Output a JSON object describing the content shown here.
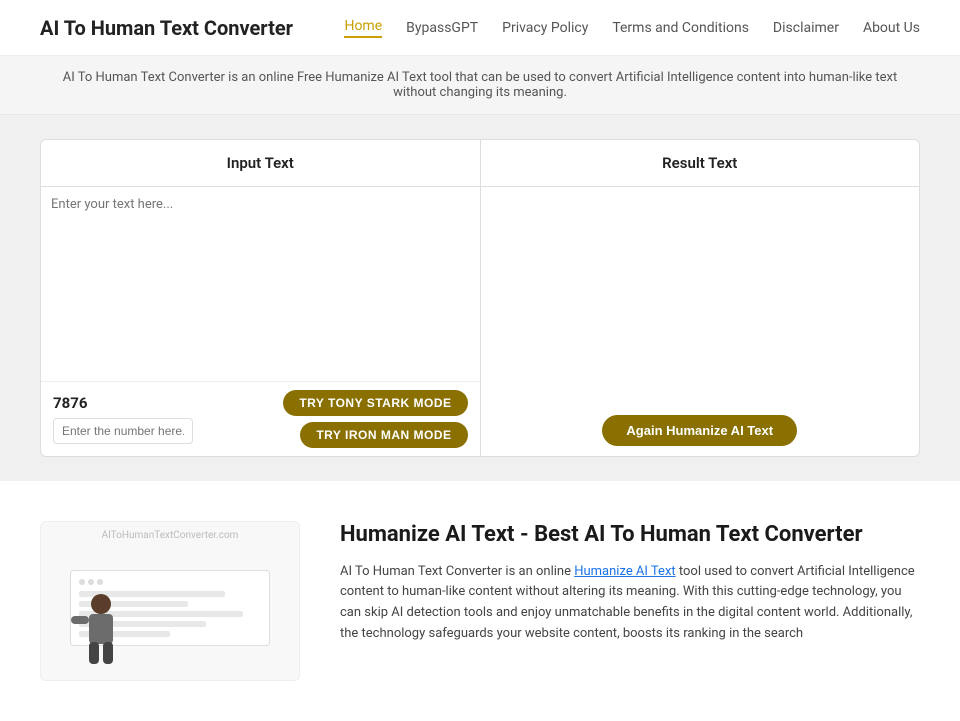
{
  "header": {
    "logo": "AI To Human Text Converter",
    "nav": [
      {
        "label": "Home",
        "active": true
      },
      {
        "label": "BypassGPT",
        "active": false
      },
      {
        "label": "Privacy Policy",
        "active": false
      },
      {
        "label": "Terms and Conditions",
        "active": false
      },
      {
        "label": "Disclaimer",
        "active": false
      },
      {
        "label": "About Us",
        "active": false
      }
    ]
  },
  "subheader": {
    "text": "AI To Human Text Converter is an online Free Humanize AI Text tool that can be used to convert Artificial Intelligence content into human-like text without changing its meaning."
  },
  "tool": {
    "input_panel_title": "Input Text",
    "result_panel_title": "Result Text",
    "input_placeholder": "Enter your text here...",
    "char_count": "7876",
    "btn_tony": "TRY TONY STARK MODE",
    "btn_iron": "TRY IRON MAN MODE",
    "number_placeholder": "Enter the number here..",
    "btn_humanize": "Again Humanize AI Text"
  },
  "bottom": {
    "illus_url": "AIToHumanTextConverter.com",
    "heading": "Humanize AI Text - Best AI To Human Text Converter",
    "paragraph": "AI To Human Text Converter is an online Humanize AI Text tool used to convert Artificial Intelligence content to human-like content without altering its meaning. With this cutting-edge technology, you can skip AI detection tools and enjoy unmatchable benefits in the digital content world. Additionally, the technology safeguards your website content, boosts its ranking in the search",
    "link_text": "Humanize AI Text"
  }
}
